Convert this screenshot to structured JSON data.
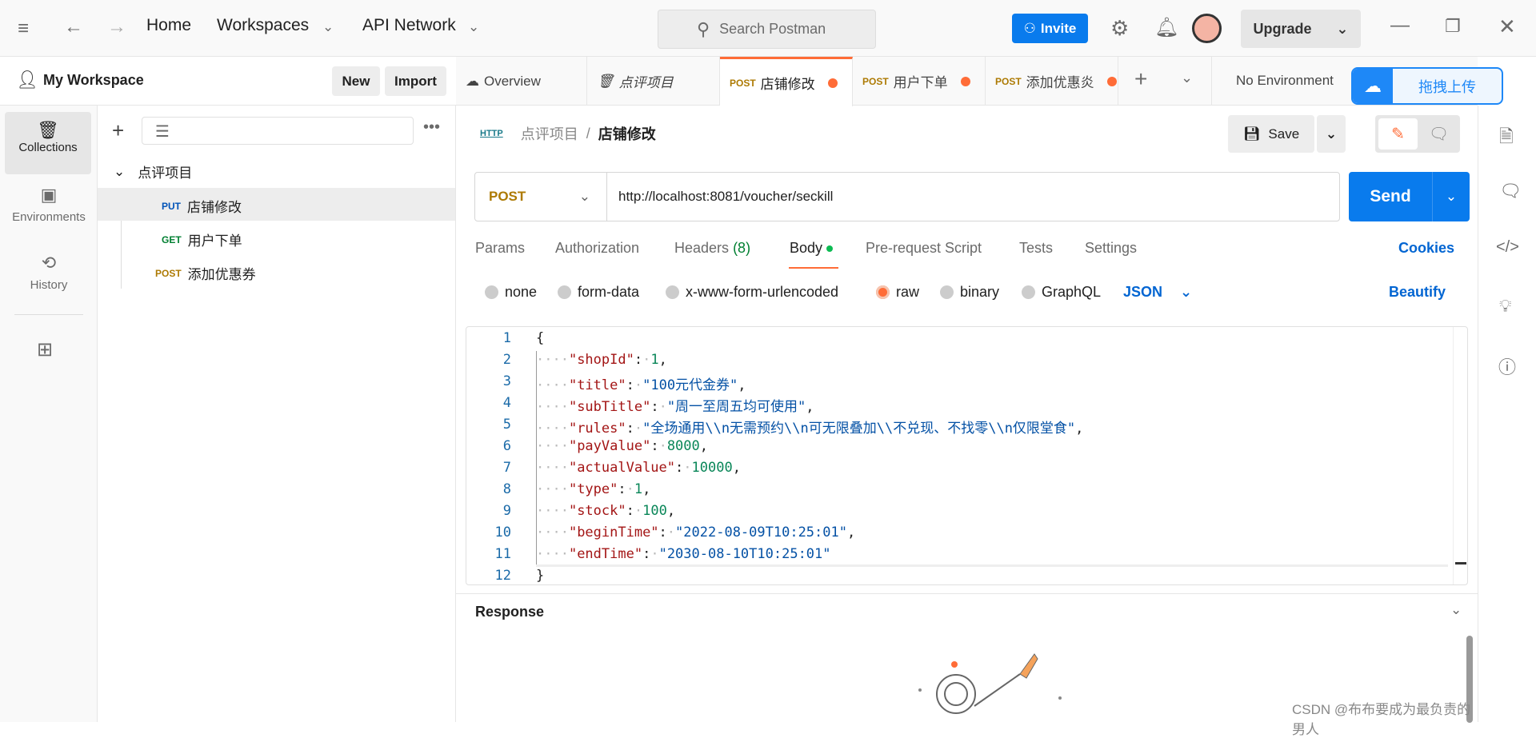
{
  "topbar": {
    "home": "Home",
    "workspaces": "Workspaces",
    "api_network": "API Network",
    "search_placeholder": "Search Postman",
    "invite": "Invite",
    "upgrade": "Upgrade"
  },
  "workspace": {
    "name": "My Workspace",
    "new": "New",
    "import": "Import"
  },
  "leftnav": [
    {
      "label": "Collections",
      "icon": "collections-icon"
    },
    {
      "label": "Environments",
      "icon": "environments-icon"
    },
    {
      "label": "History",
      "icon": "history-icon"
    }
  ],
  "tree": {
    "collection": "点评项目",
    "items": [
      {
        "method": "PUT",
        "name": "店铺修改",
        "color": "#0053b8"
      },
      {
        "method": "GET",
        "name": "用户下单",
        "color": "#007f31"
      },
      {
        "method": "POST",
        "name": "添加优惠券",
        "color": "#ad7a03"
      }
    ]
  },
  "tabs": [
    {
      "label": "Overview"
    },
    {
      "label": "点评项目"
    },
    {
      "method": "POST",
      "label": "店铺修改"
    },
    {
      "method": "POST",
      "label": "用户下单"
    },
    {
      "method": "POST",
      "label": "添加优惠炎"
    }
  ],
  "environment": "No Environment",
  "upload_overlay": "拖拽上传",
  "breadcrumb": {
    "icon": "HTTP",
    "parent": "点评项目",
    "sep": "/",
    "current": "店铺修改"
  },
  "save": "Save",
  "request": {
    "method": "POST",
    "url": "http://localhost:8081/voucher/seckill",
    "send": "Send"
  },
  "req_tabs": {
    "params": "Params",
    "authorization": "Authorization",
    "headers": "Headers",
    "headers_count": "(8)",
    "body": "Body",
    "prerequest": "Pre-request Script",
    "tests": "Tests",
    "settings": "Settings",
    "cookies": "Cookies"
  },
  "body_types": {
    "none": "none",
    "form_data": "form-data",
    "urlencoded": "x-www-form-urlencoded",
    "raw": "raw",
    "binary": "binary",
    "graphql": "GraphQL",
    "format": "JSON",
    "beautify": "Beautify",
    "selected": "raw"
  },
  "code_lines": [
    {
      "n": "1",
      "parts": [
        [
          "p",
          "{"
        ]
      ]
    },
    {
      "n": "2",
      "parts": [
        [
          "ws",
          "····"
        ],
        [
          "k",
          "\"shopId\""
        ],
        [
          "p",
          ":"
        ],
        [
          "ws",
          "·"
        ],
        [
          "n",
          "1"
        ],
        [
          "p",
          ","
        ]
      ]
    },
    {
      "n": "3",
      "parts": [
        [
          "ws",
          "····"
        ],
        [
          "k",
          "\"title\""
        ],
        [
          "p",
          ":"
        ],
        [
          "ws",
          "·"
        ],
        [
          "s",
          "\"100元代金券\""
        ],
        [
          "p",
          ","
        ]
      ]
    },
    {
      "n": "4",
      "parts": [
        [
          "ws",
          "····"
        ],
        [
          "k",
          "\"subTitle\""
        ],
        [
          "p",
          ":"
        ],
        [
          "ws",
          "·"
        ],
        [
          "s",
          "\"周一至周五均可使用\""
        ],
        [
          "p",
          ","
        ]
      ]
    },
    {
      "n": "5",
      "parts": [
        [
          "ws",
          "····"
        ],
        [
          "k",
          "\"rules\""
        ],
        [
          "p",
          ":"
        ],
        [
          "ws",
          "·"
        ],
        [
          "s",
          "\"全场通用\\\\n无需预约\\\\n可无限叠加\\\\不兑现、不找零\\\\n仅限堂食\""
        ],
        [
          "p",
          ","
        ]
      ]
    },
    {
      "n": "6",
      "parts": [
        [
          "ws",
          "····"
        ],
        [
          "k",
          "\"payValue\""
        ],
        [
          "p",
          ":"
        ],
        [
          "ws",
          "·"
        ],
        [
          "n",
          "8000"
        ],
        [
          "p",
          ","
        ]
      ]
    },
    {
      "n": "7",
      "parts": [
        [
          "ws",
          "····"
        ],
        [
          "k",
          "\"actualValue\""
        ],
        [
          "p",
          ":"
        ],
        [
          "ws",
          "·"
        ],
        [
          "n",
          "10000"
        ],
        [
          "p",
          ","
        ]
      ]
    },
    {
      "n": "8",
      "parts": [
        [
          "ws",
          "····"
        ],
        [
          "k",
          "\"type\""
        ],
        [
          "p",
          ":"
        ],
        [
          "ws",
          "·"
        ],
        [
          "n",
          "1"
        ],
        [
          "p",
          ","
        ]
      ]
    },
    {
      "n": "9",
      "parts": [
        [
          "ws",
          "····"
        ],
        [
          "k",
          "\"stock\""
        ],
        [
          "p",
          ":"
        ],
        [
          "ws",
          "·"
        ],
        [
          "n",
          "100"
        ],
        [
          "p",
          ","
        ]
      ]
    },
    {
      "n": "10",
      "parts": [
        [
          "ws",
          "····"
        ],
        [
          "k",
          "\"beginTime\""
        ],
        [
          "p",
          ":"
        ],
        [
          "ws",
          "·"
        ],
        [
          "s",
          "\"2022-08-09T10:25:01\""
        ],
        [
          "p",
          ","
        ]
      ]
    },
    {
      "n": "11",
      "parts": [
        [
          "ws",
          "····"
        ],
        [
          "k",
          "\"endTime\""
        ],
        [
          "p",
          ":"
        ],
        [
          "ws",
          "·"
        ],
        [
          "s",
          "\"2030-08-10T10:25:01\""
        ]
      ]
    },
    {
      "n": "12",
      "parts": [
        [
          "p",
          "}"
        ]
      ]
    }
  ],
  "response": {
    "title": "Response"
  },
  "watermark": "CSDN @布布要成为最负责的男人",
  "colors": {
    "accent": "#ff6c37",
    "primary": "#097bed",
    "post": "#ad7a03"
  }
}
